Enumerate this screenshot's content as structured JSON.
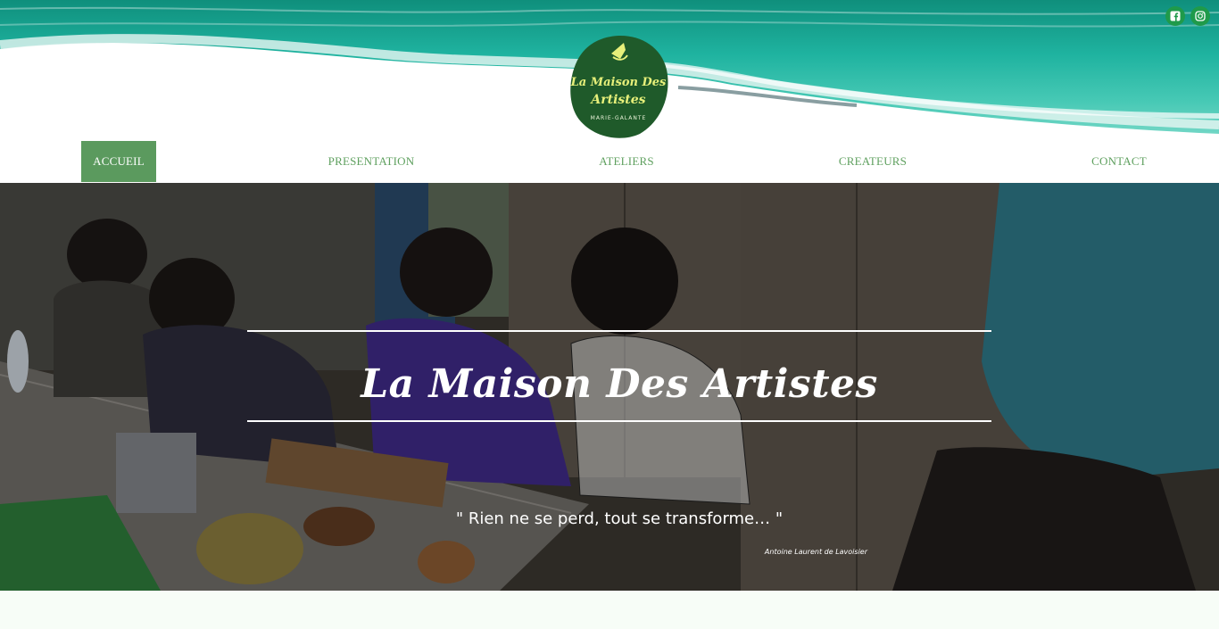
{
  "site": {
    "logo": {
      "line1": "La Maison Des",
      "line2": "Artistes",
      "line3": "MARIE-GALANTE"
    }
  },
  "social": [
    {
      "name": "facebook-icon",
      "glyph": "f"
    },
    {
      "name": "instagram-icon",
      "glyph": "◎"
    }
  ],
  "nav": {
    "items": [
      {
        "label": "ACCUEIL",
        "active": true
      },
      {
        "label": "PRESENTATION",
        "active": false
      },
      {
        "label": "ATELIERS",
        "active": false
      },
      {
        "label": "CREATEURS",
        "active": false
      },
      {
        "label": "CONTACT",
        "active": false
      }
    ]
  },
  "hero": {
    "title": "La Maison Des Artistes",
    "quote": "\" Rien ne se perd, tout se transforme… \"",
    "author": "Antoine Laurent de Lavoisier"
  },
  "colors": {
    "brand_green": "#5b9a5e",
    "logo_green": "#1f5a2a",
    "logo_text": "#e7f07a",
    "social_green": "#1f9a4a"
  }
}
